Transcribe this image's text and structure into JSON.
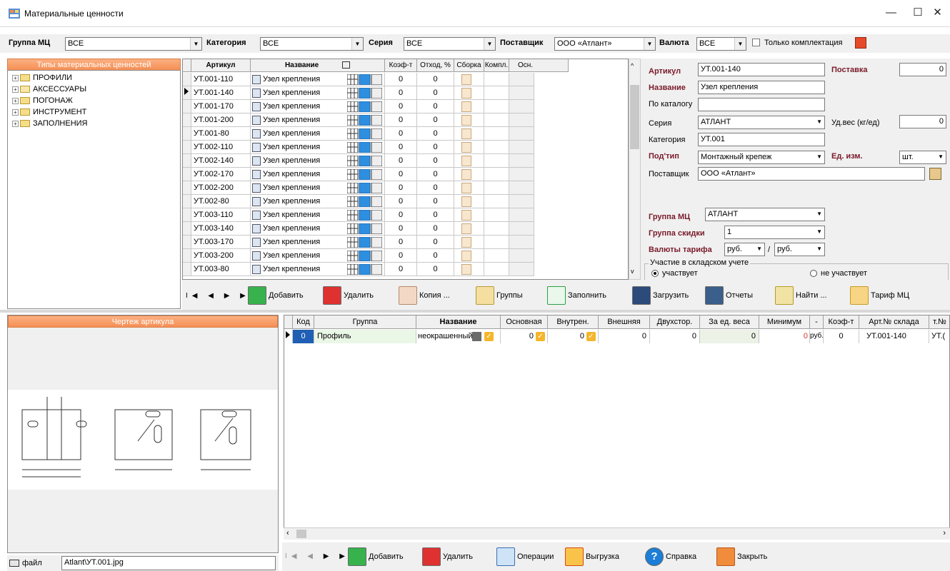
{
  "window": {
    "title": "Материальные ценности",
    "min": "—",
    "max": "☐",
    "close": "✕"
  },
  "filters": {
    "group_label": "Группа МЦ",
    "group_value": "ВСЕ",
    "category_label": "Категория",
    "category_value": "ВСЕ",
    "series_label": "Серия",
    "series_value": "ВСЕ",
    "supplier_label": "Поставщик",
    "supplier_value": "ООО «Атлант»",
    "currency_label": "Валюта",
    "currency_value": "ВСЕ",
    "only_kit_label": "Только комплектация"
  },
  "tree": {
    "header": "Типы материальных ценностей",
    "items": [
      "ПРОФИЛИ",
      "АКСЕССУАРЫ",
      "ПОГОНАЖ",
      "ИНСТРУМЕНТ",
      "ЗАПОЛНЕНИЯ"
    ]
  },
  "grid": {
    "columns": [
      "Артикул",
      "Название",
      "Коэф-т",
      "Отход, %",
      "Сборка",
      "Компл.",
      "Осн."
    ],
    "rows": [
      {
        "art": "УТ.001-110",
        "name": "Узел крепления",
        "k": "0",
        "o": "0"
      },
      {
        "art": "УТ.001-140",
        "name": "Узел крепления",
        "k": "0",
        "o": "0"
      },
      {
        "art": "УТ.001-170",
        "name": "Узел крепления",
        "k": "0",
        "o": "0"
      },
      {
        "art": "УТ.001-200",
        "name": "Узел крепления",
        "k": "0",
        "o": "0"
      },
      {
        "art": "УТ.001-80",
        "name": "Узел крепления",
        "k": "0",
        "o": "0"
      },
      {
        "art": "УТ.002-110",
        "name": "Узел крепления",
        "k": "0",
        "o": "0"
      },
      {
        "art": "УТ.002-140",
        "name": "Узел крепления",
        "k": "0",
        "o": "0"
      },
      {
        "art": "УТ.002-170",
        "name": "Узел крепления",
        "k": "0",
        "o": "0"
      },
      {
        "art": "УТ.002-200",
        "name": "Узел крепления",
        "k": "0",
        "o": "0"
      },
      {
        "art": "УТ.002-80",
        "name": "Узел крепления",
        "k": "0",
        "o": "0"
      },
      {
        "art": "УТ.003-110",
        "name": "Узел крепления",
        "k": "0",
        "o": "0"
      },
      {
        "art": "УТ.003-140",
        "name": "Узел крепления",
        "k": "0",
        "o": "0"
      },
      {
        "art": "УТ.003-170",
        "name": "Узел крепления",
        "k": "0",
        "o": "0"
      },
      {
        "art": "УТ.003-200",
        "name": "Узел крепления",
        "k": "0",
        "o": "0"
      },
      {
        "art": "УТ.003-80",
        "name": "Узел крепления",
        "k": "0",
        "o": "0"
      }
    ]
  },
  "props": {
    "article_label": "Артикул",
    "article_value": "УТ.001-140",
    "supply_label": "Поставка",
    "supply_value": "0",
    "name_label": "Название",
    "name_value": "Узел крепления",
    "catalog_label": "По каталогу",
    "catalog_value": "",
    "series_label": "Серия",
    "series_value": "АТЛАНТ",
    "weight_label": "Уд.вес (кг/ед)",
    "weight_value": "0",
    "category_label": "Категория",
    "category_value": "УТ.001",
    "subtype_label": "Под'тип",
    "subtype_value": "Монтажный крепеж",
    "unit_label": "Ед. изм.",
    "unit_value": "шт.",
    "supplier_label": "Поставщик",
    "supplier_value": "ООО «Атлант»",
    "mc_group_label": "Группа МЦ",
    "mc_group_value": "АТЛАНТ",
    "discount_label": "Группа скидки",
    "discount_value": "1",
    "tariff_label": "Валюты тарифа",
    "tariff_value1": "руб.",
    "tariff_sep": "/",
    "tariff_value2": "руб.",
    "stock_label": "Участие в складском учете",
    "stock_yes": "участвует",
    "stock_no": "не участвует"
  },
  "toolbar": {
    "add": "Добавить",
    "delete": "Удалить",
    "copy": "Копия ...",
    "groups": "Группы",
    "fill": "Заполнить",
    "load": "Загрузить",
    "reports": "Отчеты",
    "find": "Найти ...",
    "tariff": "Тариф МЦ"
  },
  "drawing": {
    "header": "Чертеж артикула"
  },
  "file": {
    "label": "файл",
    "path": "Atlant\\УТ.001.jpg"
  },
  "grid2": {
    "columns": [
      "Код",
      "Группа",
      "Название",
      "Основная",
      "Внутрен.",
      "Внешняя",
      "Двухстор.",
      "За ед. веса",
      "Минимум",
      "-",
      "Коэф-т",
      "Арт.№ склада",
      "т.№"
    ],
    "row": {
      "code": "0",
      "group": "Профиль",
      "name": "неокрашенный",
      "v1": "0",
      "v2": "0",
      "v3": "0",
      "v4": "0",
      "v5": "0",
      "cur": "руб.",
      "koef": "0",
      "art": "УТ.001-140",
      "art2": "УТ.("
    }
  },
  "bottom": {
    "add": "Добавить",
    "delete": "Удалить",
    "operations": "Операции",
    "export": "Выгрузка",
    "help": "Справка",
    "close": "Закрыть"
  }
}
